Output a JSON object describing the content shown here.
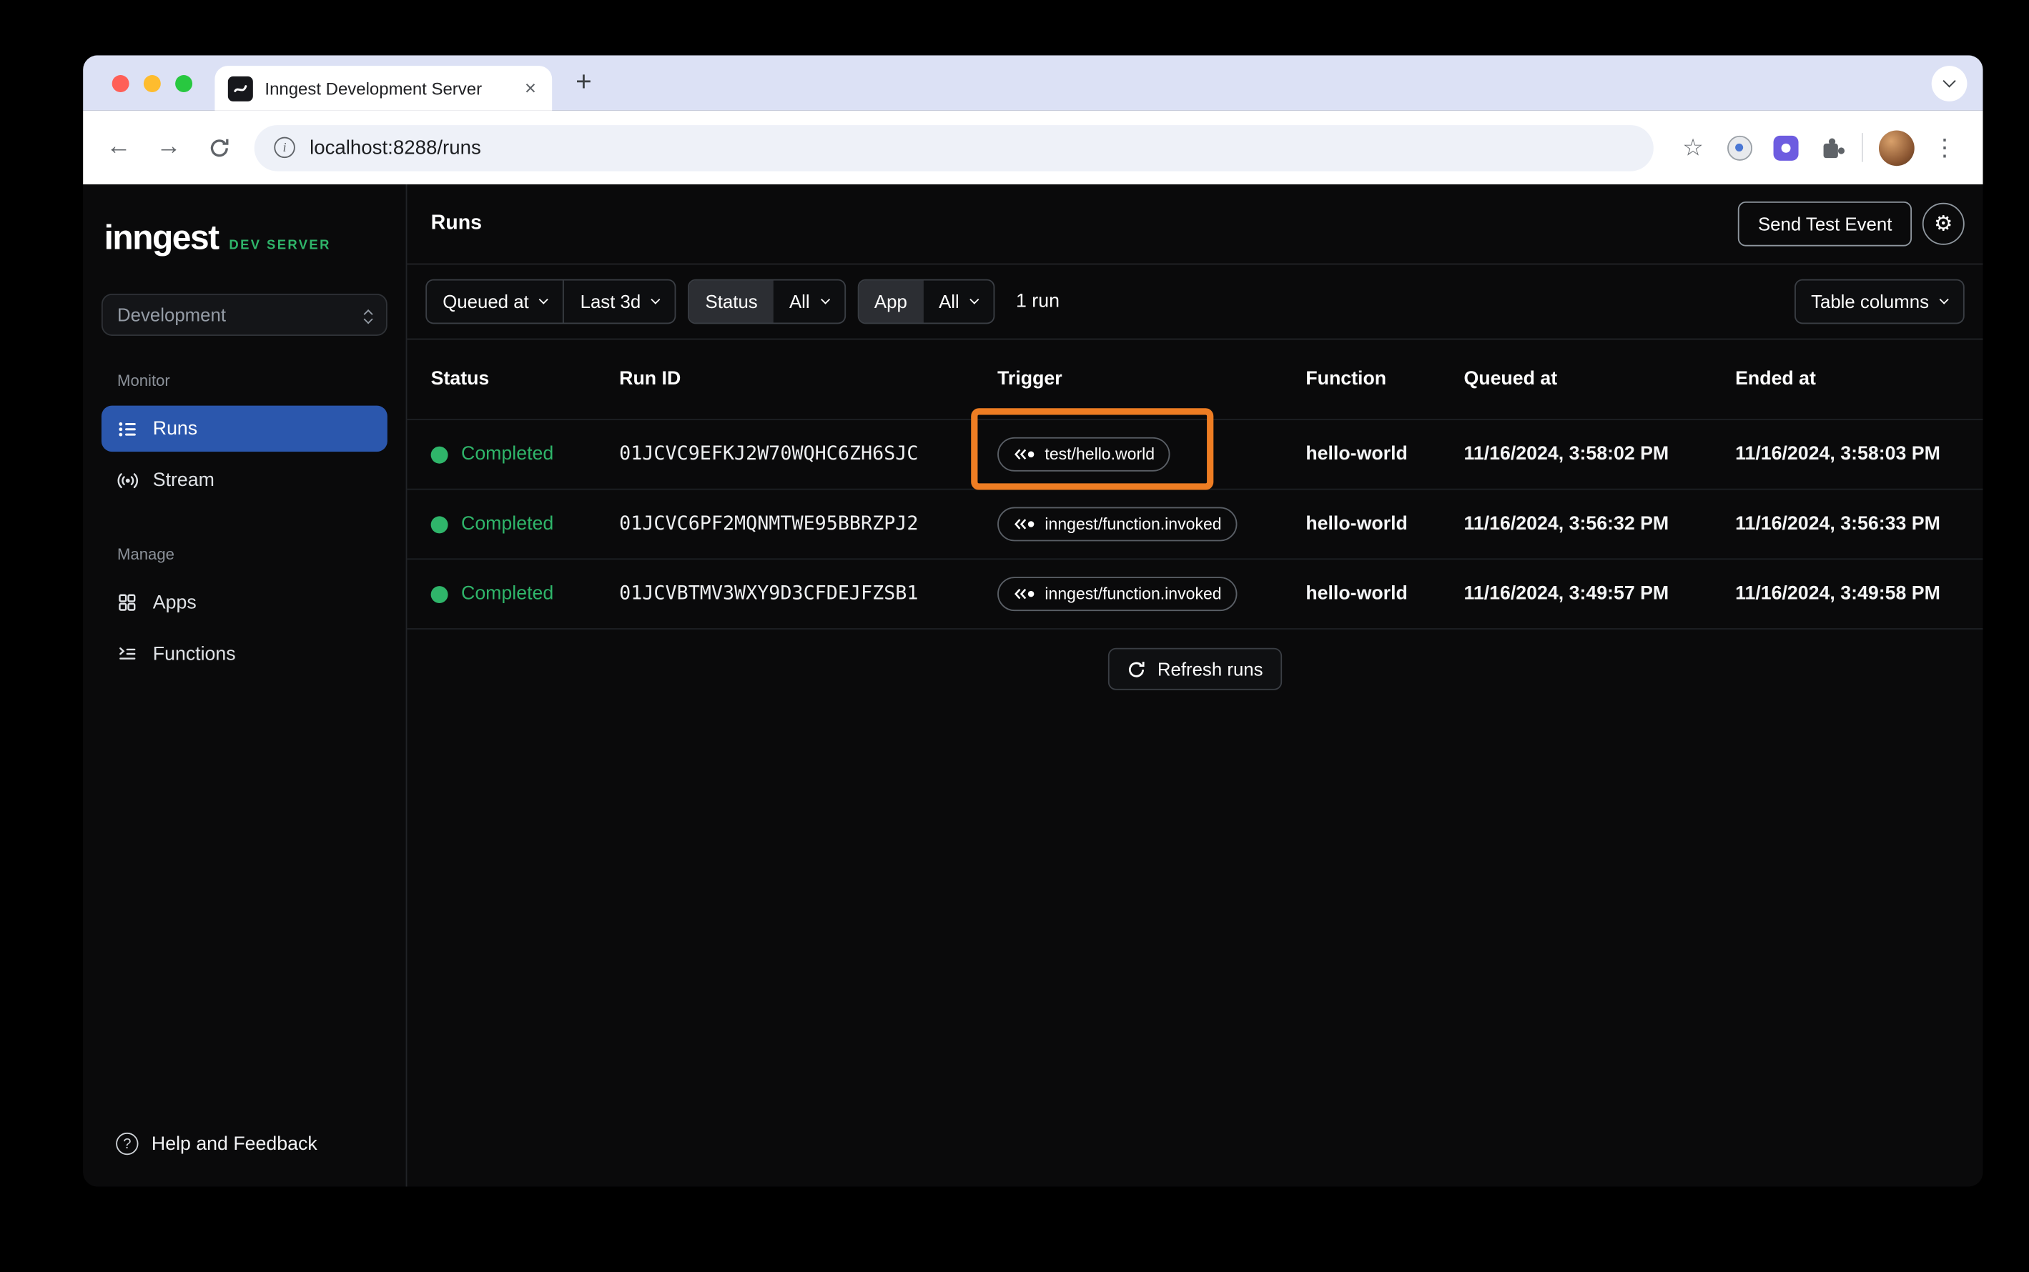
{
  "colors": {
    "accent_green": "#2fb56a",
    "active_blue": "#2b57ad",
    "highlight_orange": "#ee7d23",
    "tabstrip_bg": "#dce1f5"
  },
  "browser": {
    "tab_title": "Inngest Development Server",
    "url": "localhost:8288/runs"
  },
  "icons": {
    "close": "×",
    "new_tab": "+",
    "back": "←",
    "forward": "→",
    "kebab": "⋮",
    "star": "☆",
    "gear": "⚙",
    "info": "i",
    "help": "?"
  },
  "sidebar": {
    "logo": "inngest",
    "logo_badge": "DEV SERVER",
    "environment": "Development",
    "sections": [
      {
        "label": "Monitor",
        "items": [
          {
            "label": "Runs"
          },
          {
            "label": "Stream"
          }
        ]
      },
      {
        "label": "Manage",
        "items": [
          {
            "label": "Apps"
          },
          {
            "label": "Functions"
          }
        ]
      }
    ],
    "help": "Help and Feedback"
  },
  "header": {
    "title": "Runs",
    "send_test_event": "Send Test Event"
  },
  "filters": {
    "field": "Queued at",
    "range": "Last 3d",
    "status_label": "Status",
    "status_value": "All",
    "app_label": "App",
    "app_value": "All",
    "run_count": "1 run",
    "table_columns": "Table columns"
  },
  "table": {
    "columns": [
      "Status",
      "Run ID",
      "Trigger",
      "Function",
      "Queued at",
      "Ended at"
    ],
    "rows": [
      {
        "status": "Completed",
        "run_id": "01JCVC9EFKJ2W70WQHC6ZH6SJC",
        "trigger": "test/hello.world",
        "function": "hello-world",
        "queued_at": "11/16/2024, 3:58:02 PM",
        "ended_at": "11/16/2024, 3:58:03 PM"
      },
      {
        "status": "Completed",
        "run_id": "01JCVC6PF2MQNMTWE95BBRZPJ2",
        "trigger": "inngest/function.invoked",
        "function": "hello-world",
        "queued_at": "11/16/2024, 3:56:32 PM",
        "ended_at": "11/16/2024, 3:56:33 PM"
      },
      {
        "status": "Completed",
        "run_id": "01JCVBTMV3WXY9D3CFDEJFZSB1",
        "trigger": "inngest/function.invoked",
        "function": "hello-world",
        "queued_at": "11/16/2024, 3:49:57 PM",
        "ended_at": "11/16/2024, 3:49:58 PM"
      }
    ],
    "refresh": "Refresh runs"
  }
}
